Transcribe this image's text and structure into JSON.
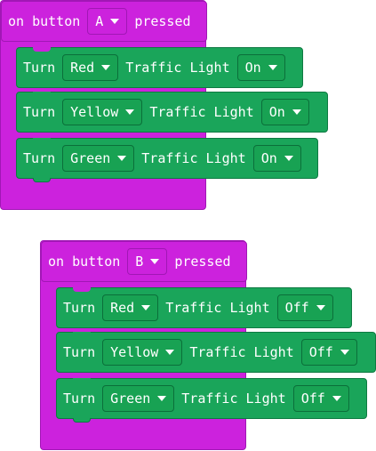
{
  "colors": {
    "event_block": "#cc22dd",
    "event_border": "#a117b5",
    "statement_block": "#1aa55a",
    "statement_border": "#0e7a42",
    "text": "#ffffff"
  },
  "events": [
    {
      "prefix": "on button",
      "button": "A",
      "suffix": "pressed",
      "statements": [
        {
          "turn": "Turn",
          "color": "Red",
          "traffic": "Traffic Light",
          "state": "On"
        },
        {
          "turn": "Turn",
          "color": "Yellow",
          "traffic": "Traffic Light",
          "state": "On"
        },
        {
          "turn": "Turn",
          "color": "Green",
          "traffic": "Traffic Light",
          "state": "On"
        }
      ]
    },
    {
      "prefix": "on button",
      "button": "B",
      "suffix": "pressed",
      "statements": [
        {
          "turn": "Turn",
          "color": "Red",
          "traffic": "Traffic Light",
          "state": "Off"
        },
        {
          "turn": "Turn",
          "color": "Yellow",
          "traffic": "Traffic Light",
          "state": "Off"
        },
        {
          "turn": "Turn",
          "color": "Green",
          "traffic": "Traffic Light",
          "state": "Off"
        }
      ]
    }
  ],
  "icons": {
    "dropdown": "caret-down-icon"
  }
}
